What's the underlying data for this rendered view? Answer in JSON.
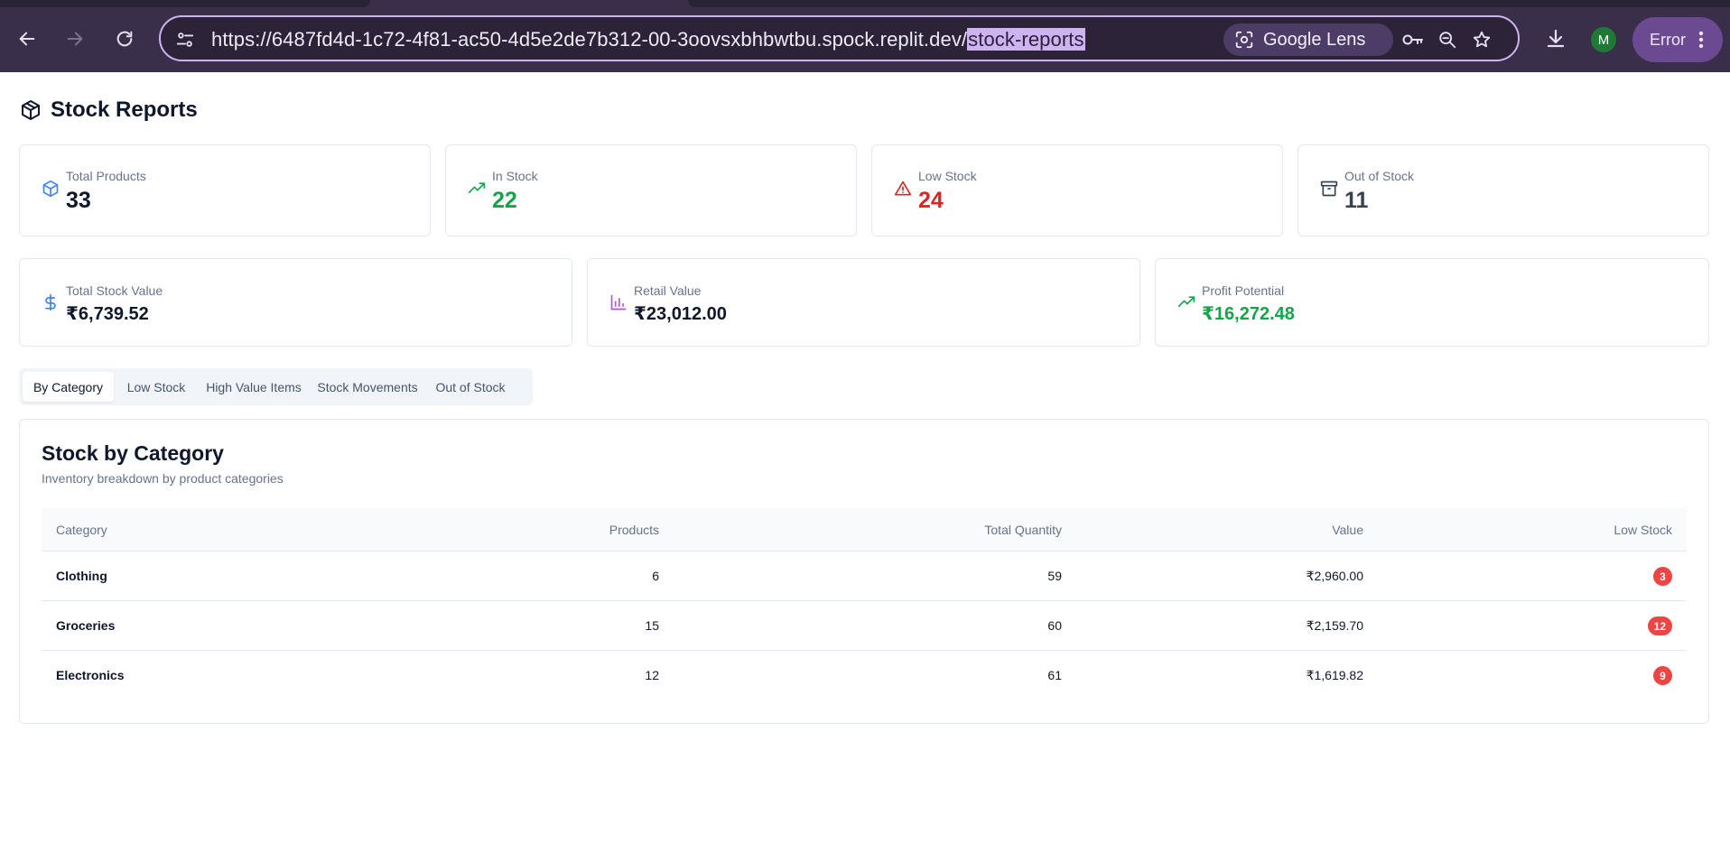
{
  "browser": {
    "url_prefix": "https://6487fd4d-1c72-4f81-ac50-4d5e2de7b312-00-3oovsxbhbwtbu.spock.replit.dev/",
    "url_selected": "stock-reports",
    "lens_label": "Google Lens",
    "profile_initial": "M",
    "error_label": "Error"
  },
  "page": {
    "title": "Stock Reports"
  },
  "stats_top": [
    {
      "label": "Total Products",
      "value": "33",
      "color": "#0f172a",
      "icon": "box-icon"
    },
    {
      "label": "In Stock",
      "value": "22",
      "color": "#16a34a",
      "icon": "trending-up-icon"
    },
    {
      "label": "Low Stock",
      "value": "24",
      "color": "#dc2626",
      "icon": "alert-triangle-icon"
    },
    {
      "label": "Out of Stock",
      "value": "11",
      "color": "#374151",
      "icon": "archive-icon"
    }
  ],
  "stats_value": [
    {
      "label": "Total Stock Value",
      "value": "₹6,739.52",
      "color": "#0f172a",
      "icon": "dollar-icon"
    },
    {
      "label": "Retail Value",
      "value": "₹23,012.00",
      "color": "#0f172a",
      "icon": "bar-chart-icon"
    },
    {
      "label": "Profit Potential",
      "value": "₹16,272.48",
      "color": "#16a34a",
      "icon": "trending-up-icon"
    }
  ],
  "tabs": [
    {
      "label": "By Category",
      "active": true
    },
    {
      "label": "Low Stock",
      "active": false
    },
    {
      "label": "High Value Items",
      "active": false
    },
    {
      "label": "Stock Movements",
      "active": false
    },
    {
      "label": "Out of Stock",
      "active": false
    }
  ],
  "panel": {
    "title": "Stock by Category",
    "subtitle": "Inventory breakdown by product categories",
    "columns": [
      "Category",
      "Products",
      "Total Quantity",
      "Value",
      "Low Stock"
    ],
    "rows": [
      {
        "category": "Clothing",
        "products": "6",
        "quantity": "59",
        "value": "₹2,960.00",
        "low_stock": "3"
      },
      {
        "category": "Groceries",
        "products": "15",
        "quantity": "60",
        "value": "₹2,159.70",
        "low_stock": "12"
      },
      {
        "category": "Electronics",
        "products": "12",
        "quantity": "61",
        "value": "₹1,619.82",
        "low_stock": "9"
      }
    ]
  },
  "colors": {
    "accent_blue": "#3b82f6",
    "green": "#16a34a",
    "red": "#dc2626",
    "purple": "#a855f7",
    "badge_red": "#ef4444"
  }
}
